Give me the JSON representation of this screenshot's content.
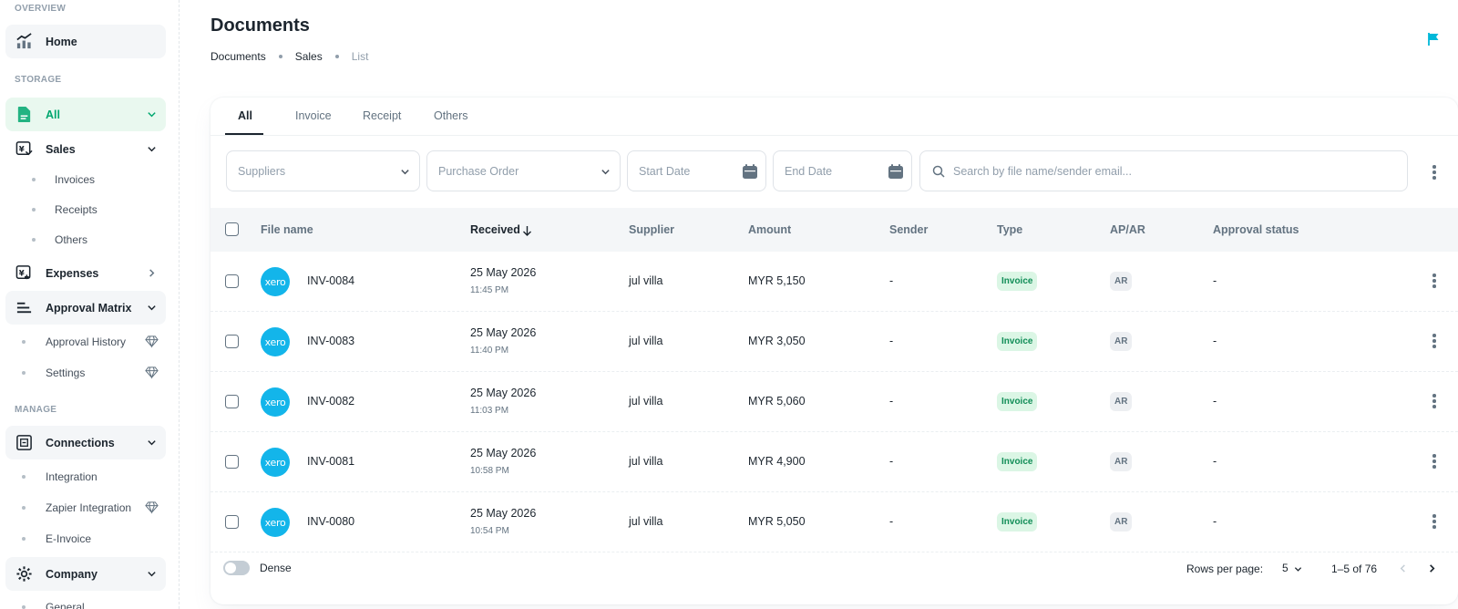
{
  "sidebar": {
    "overview_title": "OVERVIEW",
    "storage_title": "STORAGE",
    "manage_title": "MANAGE",
    "home": "Home",
    "all": "All",
    "sales": "Sales",
    "sales_items": [
      "Invoices",
      "Receipts",
      "Others"
    ],
    "expenses": "Expenses",
    "approval_matrix": "Approval Matrix",
    "approval_items": [
      "Approval History",
      "Settings"
    ],
    "connections": "Connections",
    "connection_items": [
      "Integration",
      "Zapier Integration",
      "E-Invoice"
    ],
    "company": "Company",
    "company_items": [
      "General"
    ]
  },
  "header": {
    "title": "Documents",
    "breadcrumb": [
      "Documents",
      "Sales",
      "List"
    ]
  },
  "tabs": [
    "All",
    "Invoice",
    "Receipt",
    "Others"
  ],
  "filters": {
    "suppliers_placeholder": "Suppliers",
    "purchase_order_placeholder": "Purchase Order",
    "start_date_placeholder": "Start Date",
    "end_date_placeholder": "End Date",
    "search_placeholder": "Search by file name/sender email..."
  },
  "table": {
    "columns": [
      "File name",
      "Received",
      "Supplier",
      "Amount",
      "Sender",
      "Type",
      "AP/AR",
      "Approval status"
    ],
    "logo_text": "xero",
    "rows": [
      {
        "file": "INV-0084",
        "date": "25 May 2026",
        "time": "11:45 PM",
        "supplier": "jul villa",
        "amount": "MYR 5,150",
        "sender": "-",
        "type": "Invoice",
        "apar": "AR",
        "approval": "-"
      },
      {
        "file": "INV-0083",
        "date": "25 May 2026",
        "time": "11:40 PM",
        "supplier": "jul villa",
        "amount": "MYR 3,050",
        "sender": "-",
        "type": "Invoice",
        "apar": "AR",
        "approval": "-"
      },
      {
        "file": "INV-0082",
        "date": "25 May 2026",
        "time": "11:03 PM",
        "supplier": "jul villa",
        "amount": "MYR 5,060",
        "sender": "-",
        "type": "Invoice",
        "apar": "AR",
        "approval": "-"
      },
      {
        "file": "INV-0081",
        "date": "25 May 2026",
        "time": "10:58 PM",
        "supplier": "jul villa",
        "amount": "MYR 4,900",
        "sender": "-",
        "type": "Invoice",
        "apar": "AR",
        "approval": "-"
      },
      {
        "file": "INV-0080",
        "date": "25 May 2026",
        "time": "10:54 PM",
        "supplier": "jul villa",
        "amount": "MYR 5,050",
        "sender": "-",
        "type": "Invoice",
        "apar": "AR",
        "approval": "-"
      }
    ]
  },
  "footer": {
    "dense_label": "Dense",
    "rows_per_page_label": "Rows per page:",
    "rows_per_page_value": "5",
    "range": "1–5 of 76"
  },
  "colors": {
    "accent_green": "#00a76f",
    "xero_blue": "#13b5ea",
    "flag_teal": "#00b8d9"
  }
}
